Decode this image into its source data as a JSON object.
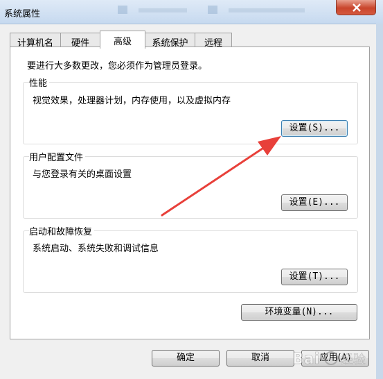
{
  "window": {
    "title": "系统属性"
  },
  "tabs": [
    {
      "label": "计算机名"
    },
    {
      "label": "硬件"
    },
    {
      "label": "高级"
    },
    {
      "label": "系统保护"
    },
    {
      "label": "远程"
    }
  ],
  "panel": {
    "admin_note": "要进行大多数更改，您必须作为管理员登录。",
    "performance": {
      "title": "性能",
      "description": "视觉效果，处理器计划，内存使用，以及虚拟内存",
      "button": "设置(S)..."
    },
    "user_profiles": {
      "title": "用户配置文件",
      "description": "与您登录有关的桌面设置",
      "button": "设置(E)..."
    },
    "startup_recovery": {
      "title": "启动和故障恢复",
      "description": "系统启动、系统失败和调试信息",
      "button": "设置(T)..."
    },
    "env_button": "环境变量(N)..."
  },
  "footer": {
    "ok": "确定",
    "cancel": "取消",
    "apply": "应用(A)"
  },
  "annotation": {
    "arrow_color": "#e8403a"
  },
  "watermark": {
    "text": "Bai 经验"
  }
}
